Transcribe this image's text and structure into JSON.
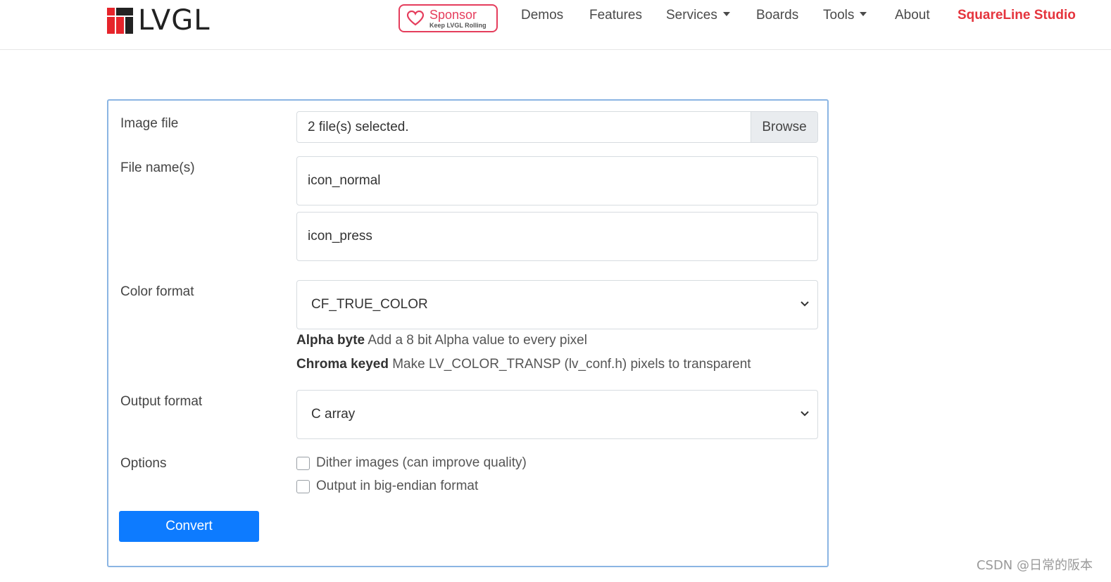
{
  "brand": {
    "name": "LVGL",
    "logo_colors": [
      "#e6242b",
      "#222222"
    ]
  },
  "sponsor": {
    "title": "Sponsor",
    "subtitle": "Keep LVGL Rolling",
    "accent": "#e53d5c"
  },
  "nav": {
    "items": [
      {
        "label": "Demos",
        "caret": false
      },
      {
        "label": "Features",
        "caret": false
      },
      {
        "label": "Services",
        "caret": true
      },
      {
        "label": "Boards",
        "caret": false
      },
      {
        "label": "Tools",
        "caret": true
      },
      {
        "label": "About",
        "caret": false
      }
    ],
    "highlight": {
      "label": "SquareLine Studio",
      "color": "#e5343d"
    }
  },
  "form": {
    "image_file": {
      "label": "Image file",
      "value": "2 file(s) selected.",
      "browse_label": "Browse"
    },
    "file_names": {
      "label": "File name(s)",
      "values": [
        "icon_normal",
        "icon_press"
      ]
    },
    "color_format": {
      "label": "Color format",
      "selected": "CF_TRUE_COLOR",
      "help": [
        {
          "term": "Alpha byte",
          "desc": "Add a 8 bit Alpha value to every pixel"
        },
        {
          "term": "Chroma keyed",
          "desc": "Make LV_COLOR_TRANSP (lv_conf.h) pixels to transparent"
        }
      ]
    },
    "output_format": {
      "label": "Output format",
      "selected": "C array"
    },
    "options": {
      "label": "Options",
      "items": [
        {
          "label": "Dither images (can improve quality)",
          "checked": false
        },
        {
          "label": "Output in big-endian format",
          "checked": false
        }
      ]
    },
    "convert_label": "Convert",
    "accent": "#0d7bff"
  },
  "watermark": "CSDN @日常的阪本"
}
